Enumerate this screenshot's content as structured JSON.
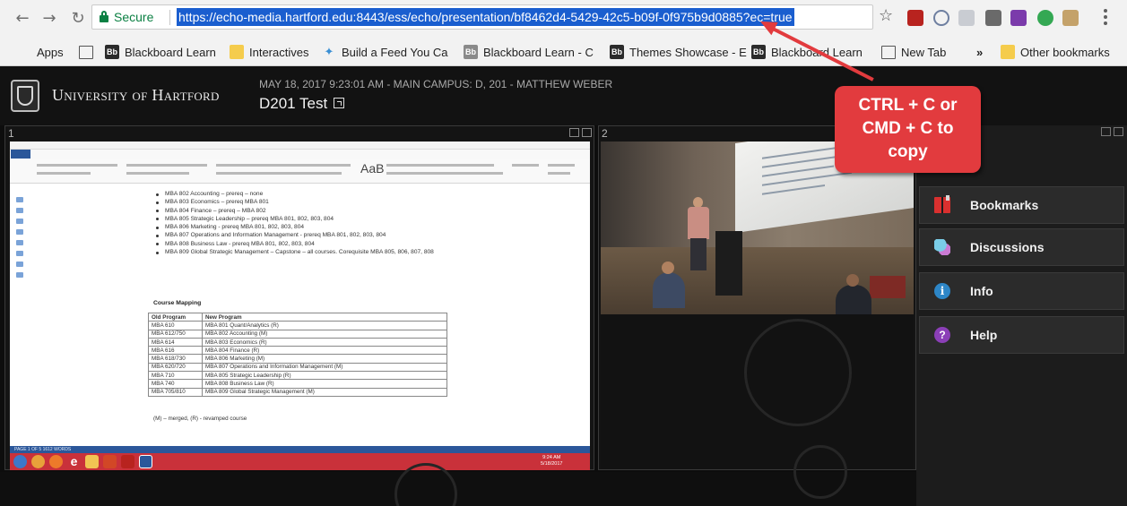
{
  "browser": {
    "security_label": "Secure",
    "url": "https://echo-media.hartford.edu:8443/ess/echo/presentation/bf8462d4-5429-42c5-b09f-0f975b9d0885?ec=true",
    "bookmarks": [
      {
        "label": "Apps",
        "icon": "apps-grid-icon"
      },
      {
        "label": "",
        "icon": "page-icon"
      },
      {
        "label": "Blackboard Learn",
        "icon": "blackboard-icon"
      },
      {
        "label": "Interactives",
        "icon": "folder-icon"
      },
      {
        "label": "Build a Feed You Ca",
        "icon": "feed-icon"
      },
      {
        "label": "Blackboard Learn - C",
        "icon": "blackboard-icon"
      },
      {
        "label": "Themes Showcase - E",
        "icon": "blackboard-icon"
      },
      {
        "label": "Blackboard Learn",
        "icon": "blackboard-icon"
      },
      {
        "label": "New Tab",
        "icon": "page-icon"
      },
      {
        "label": "»",
        "icon": ""
      },
      {
        "label": "Other bookmarks",
        "icon": "folder-icon"
      }
    ]
  },
  "header": {
    "university": "University of Hartford",
    "meta": "MAY 18, 2017 9:23:01 AM - MAIN CAMPUS: D, 201 - MATTHEW WEBER",
    "title": "D201 Test"
  },
  "panels": {
    "panel1_number": "1",
    "panel2_number": "2"
  },
  "document": {
    "styles_sample": "AaB",
    "bullets": [
      "MBA 802 Accounting – prereq – none",
      "MBA 803 Economics – prereq MBA 801",
      "MBA 804 Finance – prereq – MBA 802",
      "MBA 805 Strategic Leadership – prereq MBA 801, 802, 803, 804",
      "MBA 806 Marketing - prereq MBA 801, 802, 803, 804",
      "MBA 807 Operations and Information Management - prereq MBA 801, 802, 803, 804",
      "MBA 808 Business Law - prereq MBA 801, 802, 803, 804",
      "MBA 809 Global Strategic Management – Capstone – all courses. Corequisite MBA 805, 806, 807, 808"
    ],
    "mapping_title": "Course Mapping",
    "mapping_headers": [
      "Old Program",
      "New Program"
    ],
    "mapping_rows": [
      [
        "MBA 610",
        "MBA 801 Quant/Analytics (R)"
      ],
      [
        "MBA 612/750",
        "MBA 802 Accounting (M)"
      ],
      [
        "MBA 614",
        "MBA 803 Economics (R)"
      ],
      [
        "MBA 616",
        "MBA 804 Finance (R)"
      ],
      [
        "MBA 618/730",
        "MBA 806 Marketing (M)"
      ],
      [
        "MBA 620/720",
        "MBA 807 Operations and Information Management (M)"
      ],
      [
        "MBA 710",
        "MBA 805 Strategic Leadership (R)"
      ],
      [
        "MBA 740",
        "MBA 808 Business Law (R)"
      ],
      [
        "MBA 705/810",
        "MBA 809 Global Strategic Management (M)"
      ]
    ],
    "mapping_note": "(M) – merged, (R) - revamped course",
    "status": "PAGE 1 OF 5   1612 WORDS",
    "taskbar_time": "9:24 AM",
    "taskbar_date": "5/18/2017"
  },
  "sidebar": {
    "items": [
      {
        "label": "Bookmarks",
        "icon": "bookmarks-icon"
      },
      {
        "label": "Discussions",
        "icon": "discussions-icon"
      },
      {
        "label": "Info",
        "icon": "info-icon"
      },
      {
        "label": "Help",
        "icon": "help-icon"
      }
    ]
  },
  "callout": {
    "line1": "CTRL + C or",
    "line2": "CMD + C to",
    "line3": "copy",
    "color": "#e23b3e"
  },
  "colors": {
    "secure_green": "#0b8043",
    "url_highlight": "#1a5ecf",
    "word_blue": "#2b579a"
  }
}
